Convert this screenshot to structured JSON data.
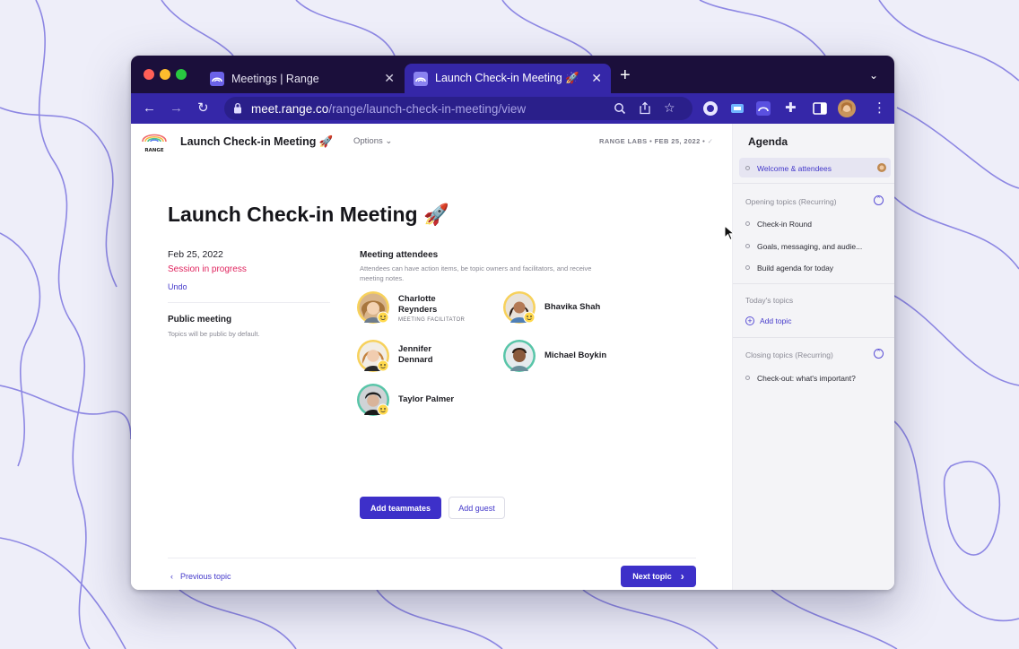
{
  "browser": {
    "tabs": [
      {
        "title": "Meetings | Range",
        "active": false
      },
      {
        "title": "Launch Check-in Meeting 🚀",
        "active": true
      }
    ],
    "url_host": "meet.range.co",
    "url_path": "/range/launch-check-in-meeting/view"
  },
  "header": {
    "logo_text": "RANGE",
    "meeting_title": "Launch Check-in Meeting 🚀",
    "options_label": "Options",
    "meta": "RANGE LABS • FEB 25, 2022 •"
  },
  "main": {
    "title": "Launch Check-in Meeting 🚀",
    "date": "Feb 25, 2022",
    "status": "Session in progress",
    "undo": "Undo",
    "public_title": "Public meeting",
    "public_desc": "Topics will be public by default.",
    "attendees_title": "Meeting attendees",
    "attendees_desc": "Attendees can have action items, be topic owners and facilitators, and receive meeting notes.",
    "attendees": [
      {
        "name_line1": "Charlotte",
        "name_line2": "Reynders",
        "role": "MEETING FACILITATOR"
      },
      {
        "name_line1": "Bhavika Shah",
        "name_line2": "",
        "role": ""
      },
      {
        "name_line1": "Jennifer",
        "name_line2": "Dennard",
        "role": ""
      },
      {
        "name_line1": "Michael Boykin",
        "name_line2": "",
        "role": ""
      },
      {
        "name_line1": "Taylor Palmer",
        "name_line2": "",
        "role": ""
      }
    ],
    "add_teammates": "Add teammates",
    "add_guest": "Add guest",
    "previous_topic": "Previous topic",
    "next_topic": "Next topic"
  },
  "agenda": {
    "title": "Agenda",
    "current_item": "Welcome & attendees",
    "opening_section": "Opening topics (Recurring)",
    "opening_items": [
      "Check-in Round",
      "Goals, messaging, and audie...",
      "Build agenda for today"
    ],
    "today_section": "Today's topics",
    "add_topic": "Add topic",
    "closing_section": "Closing topics (Recurring)",
    "closing_items": [
      "Check-out: what's important?"
    ]
  },
  "colors": {
    "accent": "#3d30c9",
    "tabstrip": "#1b0f3b",
    "toolbar": "#3527a8",
    "status_red": "#e0245e",
    "background": "#eeeef9"
  }
}
